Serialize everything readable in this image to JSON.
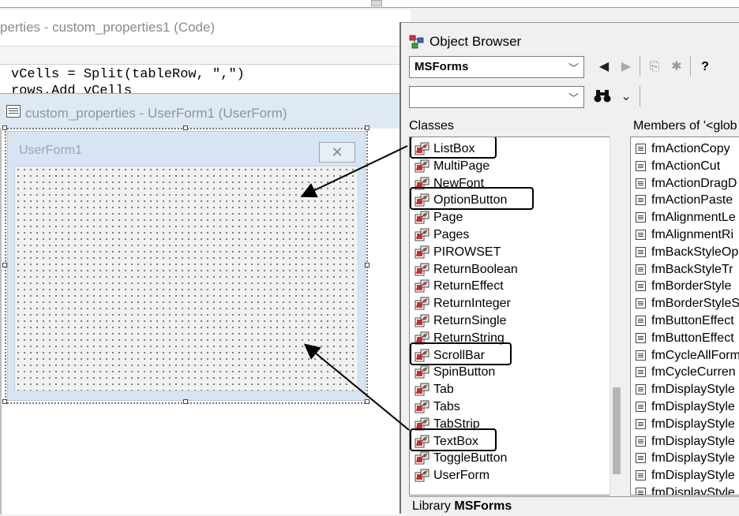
{
  "code_window": {
    "title": "perties - custom_properties1 (Code)",
    "lines": [
      "vCells = Split(tableRow, \",\")",
      "rows.Add vCells"
    ]
  },
  "userform_window": {
    "title": "custom_properties - UserForm1 (UserForm)",
    "form_caption": "UserForm1"
  },
  "object_browser": {
    "title": "Object Browser",
    "library_combo": "MSForms",
    "search_value": "",
    "classes_header": "Classes",
    "members_header": "Members of '<glob",
    "classes": [
      "ListBox",
      "MultiPage",
      "NewFont",
      "OptionButton",
      "Page",
      "Pages",
      "PIROWSET",
      "ReturnBoolean",
      "ReturnEffect",
      "ReturnInteger",
      "ReturnSingle",
      "ReturnString",
      "ScrollBar",
      "SpinButton",
      "Tab",
      "Tabs",
      "TabStrip",
      "TextBox",
      "ToggleButton",
      "UserForm"
    ],
    "highlighted_classes": [
      "ListBox",
      "OptionButton",
      "ScrollBar",
      "TextBox"
    ],
    "members": [
      "fmActionCopy",
      "fmActionCut",
      "fmActionDragD",
      "fmActionPaste",
      "fmAlignmentLe",
      "fmAlignmentRi",
      "fmBackStyleOp",
      "fmBackStyleTr",
      "fmBorderStyle",
      "fmBorderStyleS",
      "fmButtonEffect",
      "fmButtonEffect",
      "fmCycleAllForm",
      "fmCycleCurren",
      "fmDisplayStyle",
      "fmDisplayStyle",
      "fmDisplayStyle",
      "fmDisplayStyle",
      "fmDisplayStyle",
      "fmDisplayStyle",
      "fmDisplayStyle"
    ],
    "status_prefix": "Library",
    "status_library": "MSForms"
  },
  "icons": {
    "back": "back-arrow-icon",
    "forward": "forward-arrow-icon",
    "copy": "copy-icon",
    "view_definition": "view-definition-icon",
    "help": "help-icon",
    "search": "binoculars-icon",
    "toggle_results": "double-chevron-icon"
  },
  "colors": {
    "form_background": "#d7e4f2",
    "highlight_border": "#000000",
    "title_text": "#8a8a8a"
  }
}
